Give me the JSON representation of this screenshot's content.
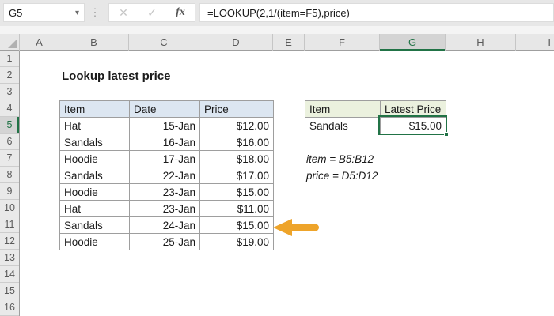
{
  "formula_bar": {
    "cell_reference": "G5",
    "dropdown_icon": "▾",
    "dots_icon": "⋮",
    "cancel_label": "✕",
    "confirm_label": "✓",
    "fx_label": "fx",
    "formula": "=LOOKUP(2,1/(item=F5),price)"
  },
  "grid": {
    "column_headers": [
      "A",
      "B",
      "C",
      "D",
      "E",
      "F",
      "G",
      "H",
      "I"
    ],
    "row_headers": [
      "1",
      "2",
      "3",
      "4",
      "5",
      "6",
      "7",
      "8",
      "9",
      "10",
      "11",
      "12",
      "13",
      "14",
      "15",
      "16"
    ],
    "selected_cell": "G5",
    "selected_column": "G",
    "selected_row": "5"
  },
  "content": {
    "title": "Lookup latest price",
    "data_table": {
      "headers": [
        "Item",
        "Date",
        "Price"
      ],
      "rows": [
        [
          "Hat",
          "15-Jan",
          "$12.00"
        ],
        [
          "Sandals",
          "16-Jan",
          "$16.00"
        ],
        [
          "Hoodie",
          "17-Jan",
          "$18.00"
        ],
        [
          "Sandals",
          "22-Jan",
          "$17.00"
        ],
        [
          "Hoodie",
          "23-Jan",
          "$15.00"
        ],
        [
          "Hat",
          "23-Jan",
          "$11.00"
        ],
        [
          "Sandals",
          "24-Jan",
          "$15.00"
        ],
        [
          "Hoodie",
          "25-Jan",
          "$19.00"
        ]
      ]
    },
    "result_table": {
      "headers": [
        "Item",
        "Latest Price"
      ],
      "rows": [
        [
          "Sandals",
          "$15.00"
        ]
      ]
    },
    "notes": [
      "item = B5:B12",
      "price = D5:D12"
    ]
  },
  "colors": {
    "excel_green": "#217346",
    "data_header_fill": "#dce6f1",
    "result_header_fill": "#ebf1de",
    "arrow_fill": "#eea42a"
  }
}
